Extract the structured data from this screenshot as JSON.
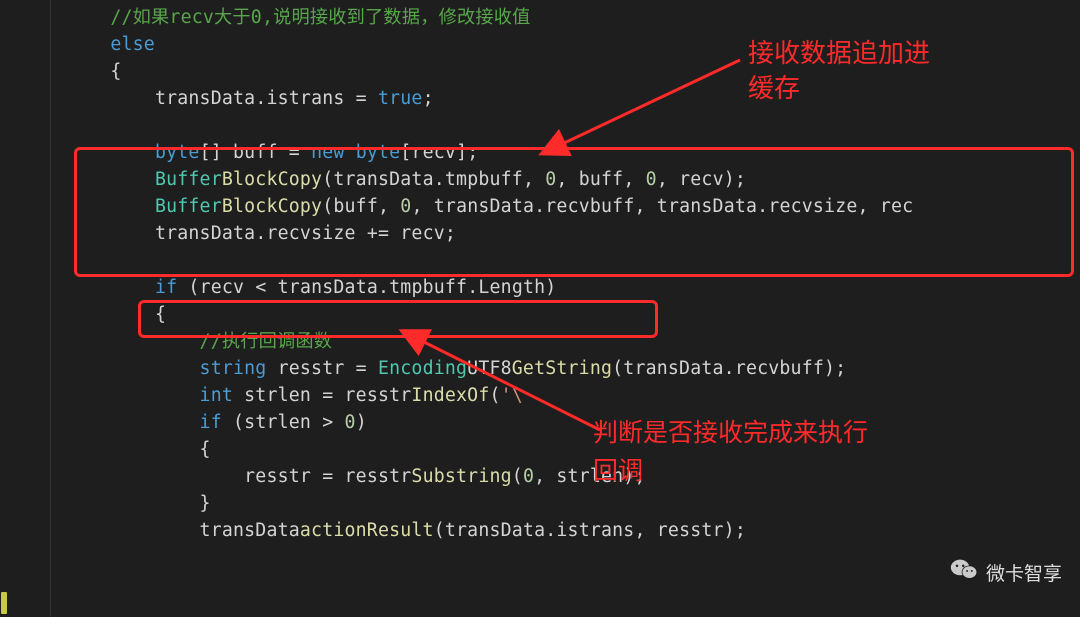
{
  "code": {
    "comment_top": "//如果recv大于0,说明接收到了数据，修改接收值",
    "else": "else",
    "istrans_assign": {
      "obj": "transData",
      "dot1": ".",
      "p": "istrans",
      " eq ": " = ",
      "val": "true",
      "semi": ";"
    },
    "buff_decl": {
      "byte": "byte",
      "brk": "[] ",
      "buff": "buff",
      " eq ": " = ",
      "new": "new ",
      "byte2": "byte",
      "open": "[",
      "recv": "recv",
      "close": "]",
      ";": ";"
    },
    "bc1": {
      "Buffer": "Buffer",
      ".": ".",
      "BlockCopy": "BlockCopy",
      "args": "(transData.tmpbuff, 0, buff, 0, recv);",
      "zero": "0",
      "recv": "recv",
      "a1": "transData",
      "a1b": "tmpbuff",
      "a3": "buff"
    },
    "bc2": {
      "Buffer": "Buffer",
      ".": ".",
      "BlockCopy": "BlockCopy",
      "a1": "buff",
      "zero": "0",
      "a3": "transData",
      "a3b": "recvbuff",
      "a5": "transData",
      "a5b": "recvsize",
      "a6": "rec"
    },
    "recvsize_inc": {
      "obj": "transData",
      "p": "recvsize",
      "op": " += ",
      "v": "recv",
      ";": ";"
    },
    "if_cond": {
      "if": "if",
      "open": " (",
      "recv": "recv",
      " lt ": " < ",
      "obj": "transData",
      "p1": "tmpbuff",
      "p2": "Length",
      "close": ")"
    },
    "comment_cb": "//执行回调函数",
    "resstr_line": {
      "string": "string",
      "var": "resstr",
      " eq ": " = ",
      "Encoding": "Encoding",
      ".": ".",
      "UTF8": "UTF8",
      ".2": ".",
      "GetString": "GetString",
      "arg": "(transData.recvbuff);",
      "argObj": "transData",
      "argP": "recvbuff"
    },
    "strlen_line": {
      "int": "int",
      "var": "strlen",
      " eq ": " = ",
      "resstr": "resstr",
      ".": ".",
      "IndexOf": "IndexOf",
      "open": "(",
      "esc": "'\\",
      "close": ");"
    },
    "if2": {
      "if": "if",
      "open": " (",
      "var": "strlen",
      " gt ": " > ",
      "zero": "0",
      "close": ")"
    },
    "substr": {
      "resstr": "resstr",
      " eq ": " = ",
      "resstr2": "resstr",
      ".": ".",
      "Substring": "Substring",
      "open": "(",
      "zero": "0",
      "comma": ", ",
      "var": "strlen",
      "close": ");"
    },
    "actionResult": {
      "obj": "transData",
      ".": ".",
      "fn": "actionResult",
      "open": "(",
      "a1": "transData",
      "a1b": "istrans",
      "comma": ", ",
      "a2": "resstr",
      "close": ");"
    }
  },
  "annotations": {
    "a1_l1": "接收数据追加进",
    "a1_l2": "缓存",
    "a2_l1": "判断是否接收完成来执行",
    "a2_l2": "回调"
  },
  "badge": {
    "text": "微卡智享"
  }
}
